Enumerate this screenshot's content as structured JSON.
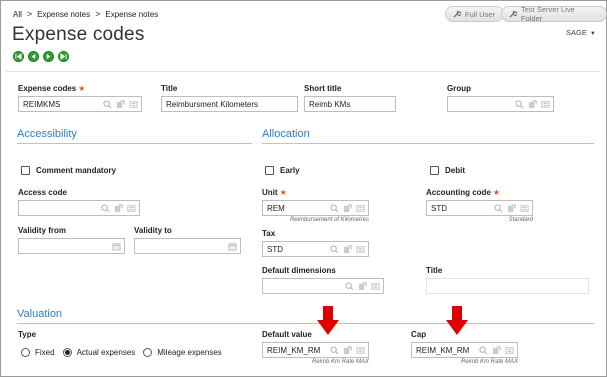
{
  "breadcrumb": [
    "All",
    "Expense notes",
    "Expense notes"
  ],
  "top_buttons": {
    "full_user": "Full User",
    "test_server": "Test Server Live Folder"
  },
  "page_title": "Expense codes",
  "user_menu": "SAGE",
  "nav_icons": [
    "first-record-icon",
    "previous-record-icon",
    "next-record-icon",
    "last-record-icon"
  ],
  "header_fields": {
    "expense_code": {
      "label": "Expense codes",
      "value": "REIMKMS"
    },
    "title": {
      "label": "Title",
      "value": "Reimbursment Kilometers"
    },
    "short_title": {
      "label": "Short title",
      "value": "Reimb KMs"
    },
    "group": {
      "label": "Group",
      "value": ""
    }
  },
  "sections": {
    "accessibility": "Accessibility",
    "allocation": "Allocation",
    "valuation": "Valuation"
  },
  "accessibility": {
    "comment_mandatory": "Comment mandatory",
    "access_code": {
      "label": "Access code",
      "value": ""
    },
    "validity_from": {
      "label": "Validity from",
      "value": ""
    },
    "validity_to": {
      "label": "Validity to",
      "value": ""
    }
  },
  "allocation": {
    "early": "Early",
    "debit": "Debit",
    "unit": {
      "label": "Unit",
      "value": "REM",
      "description": "Reimbursement of Kilometres"
    },
    "accounting_code": {
      "label": "Accounting code",
      "value": "STD",
      "description": "Standard"
    },
    "tax": {
      "label": "Tax",
      "value": "STD"
    },
    "default_dimensions": {
      "label": "Default dimensions",
      "value": ""
    },
    "title": {
      "label": "Title",
      "value": ""
    }
  },
  "valuation": {
    "type_label": "Type",
    "types": [
      "Fixed",
      "Actual expenses",
      "Mileage expenses"
    ],
    "selected_type": "Actual expenses",
    "default_value": {
      "label": "Default value",
      "value": "REIM_KM_RM",
      "description": "Reimb Km Rate MAX"
    },
    "cap": {
      "label": "Cap",
      "value": "REIM_KM_RM",
      "description": "Reimb Km Rate MAX"
    }
  },
  "colors": {
    "accent": "#2a7fc1",
    "required": "#e8541e",
    "nav_green": "#2e9e2e",
    "arrow_red": "#e00000"
  }
}
